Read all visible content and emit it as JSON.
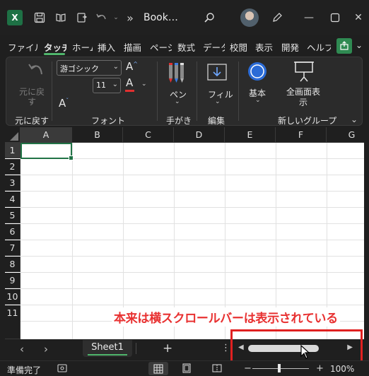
{
  "titlebar": {
    "app_icon": "excel-icon",
    "title": "Book…",
    "overflow": "»"
  },
  "tabs": [
    {
      "label": "ファイル"
    },
    {
      "label": "タッチ",
      "active": true
    },
    {
      "label": "ホーム"
    },
    {
      "label": "挿入"
    },
    {
      "label": "描画"
    },
    {
      "label": "ページ"
    },
    {
      "label": "数式"
    },
    {
      "label": "データ"
    },
    {
      "label": "校閲"
    },
    {
      "label": "表示"
    },
    {
      "label": "開発"
    },
    {
      "label": "ヘルプ"
    }
  ],
  "ribbon": {
    "undo": {
      "label": "元に戻す",
      "group": "元に戻す"
    },
    "font": {
      "name": "游ゴシック",
      "size": "11",
      "group": "フォント"
    },
    "ink": {
      "pen_label": "ペン",
      "group": "手がき"
    },
    "edit": {
      "fill_label": "フィル",
      "group": "編集"
    },
    "basic_label": "基本",
    "fullscreen_label": "全画面表示",
    "new_group_label": "新しいグループ"
  },
  "grid": {
    "columns": [
      "A",
      "B",
      "C",
      "D",
      "E",
      "F",
      "G"
    ],
    "rows": [
      "1",
      "2",
      "3",
      "4",
      "5",
      "6",
      "7",
      "8",
      "9",
      "10",
      "11"
    ],
    "selected_cell": "A1"
  },
  "annotation": "本来は横スクロールバーは表示されている",
  "sheets": {
    "active": "Sheet1",
    "add": "+"
  },
  "status": {
    "text": "準備完了",
    "zoom": "100%",
    "zoom_minus": "−",
    "zoom_plus": "+"
  },
  "colors": {
    "accent": "#4fb56b",
    "excel_green": "#217346",
    "annotation_red": "#e02020"
  }
}
